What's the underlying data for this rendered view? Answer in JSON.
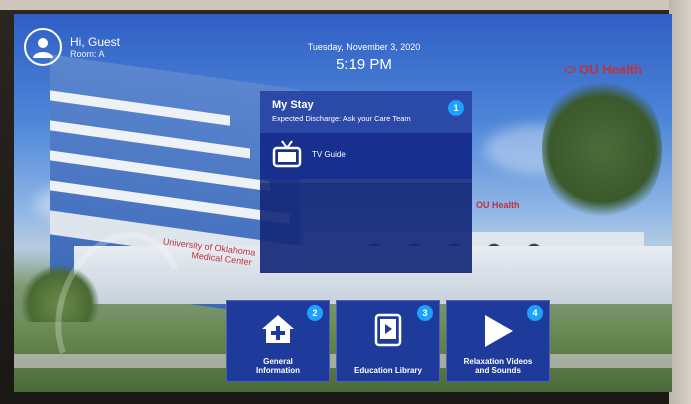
{
  "header": {
    "guest_name": "Hi, Guest",
    "room": "Room: A",
    "date": "Tuesday, November 3, 2020",
    "time": "5:19 PM"
  },
  "branding": {
    "logo": "OU Health",
    "logo_small": "OU Health",
    "building_sign_line1": "University of Oklahoma",
    "building_sign_line2": "Medical Center"
  },
  "panel": {
    "stay_title": "My Stay",
    "stay_subtitle": "Expected Discharge: Ask your Care Team",
    "stay_badge": "1",
    "tv_label": "TV Guide"
  },
  "tiles": [
    {
      "label_line1": "General",
      "label_line2": "Information",
      "badge": "2",
      "icon": "house-plus-icon"
    },
    {
      "label_line1": "Education Library",
      "label_line2": "",
      "badge": "3",
      "icon": "tablet-play-icon"
    },
    {
      "label_line1": "Relaxation Videos",
      "label_line2": "and Sounds",
      "badge": "4",
      "icon": "play-icon"
    }
  ],
  "colors": {
    "tile_bg": "#1e3a9a",
    "badge": "#1ea0ff",
    "brand_red": "#c0333a"
  }
}
